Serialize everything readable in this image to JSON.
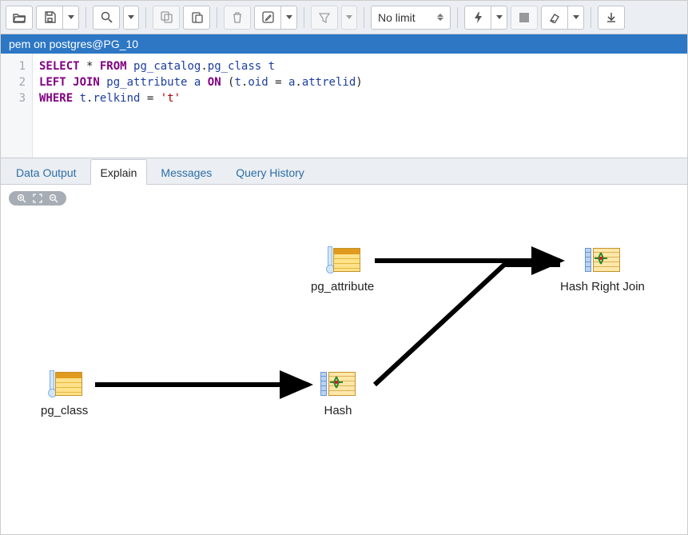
{
  "toolbar": {
    "limit_label": "No limit"
  },
  "title": "pem on postgres@PG_10",
  "sql": {
    "lines": [
      "1",
      "2",
      "3"
    ],
    "l1_select": "SELECT",
    "l1_star": " * ",
    "l1_from": "FROM",
    "l1_sp": " ",
    "l1_id1": "pg_catalog",
    "l1_dot": ".",
    "l1_id2": "pg_class",
    "l1_sp2": " ",
    "l1_id3": "t",
    "l2_left": "LEFT JOIN",
    "l2_sp": " ",
    "l2_id1": "pg_attribute",
    "l2_sp2": " ",
    "l2_id2": "a",
    "l2_sp3": " ",
    "l2_on": "ON",
    "l2_sp4": " (",
    "l2_id3": "t",
    "l2_dot1": ".",
    "l2_id4": "oid",
    "l2_eq": " = ",
    "l2_id5": "a",
    "l2_dot2": ".",
    "l2_id6": "attrelid",
    "l2_close": ")",
    "l3_where": "WHERE",
    "l3_sp": " ",
    "l3_id1": "t",
    "l3_dot": ".",
    "l3_id2": "relkind",
    "l3_eq": " = ",
    "l3_str": "'t'"
  },
  "tabs": {
    "data_output": "Data Output",
    "explain": "Explain",
    "messages": "Messages",
    "query_history": "Query History"
  },
  "plan": {
    "nodes": {
      "pg_class": "pg_class",
      "pg_attribute": "pg_attribute",
      "hash": "Hash",
      "hash_right_join": "Hash Right Join"
    }
  }
}
